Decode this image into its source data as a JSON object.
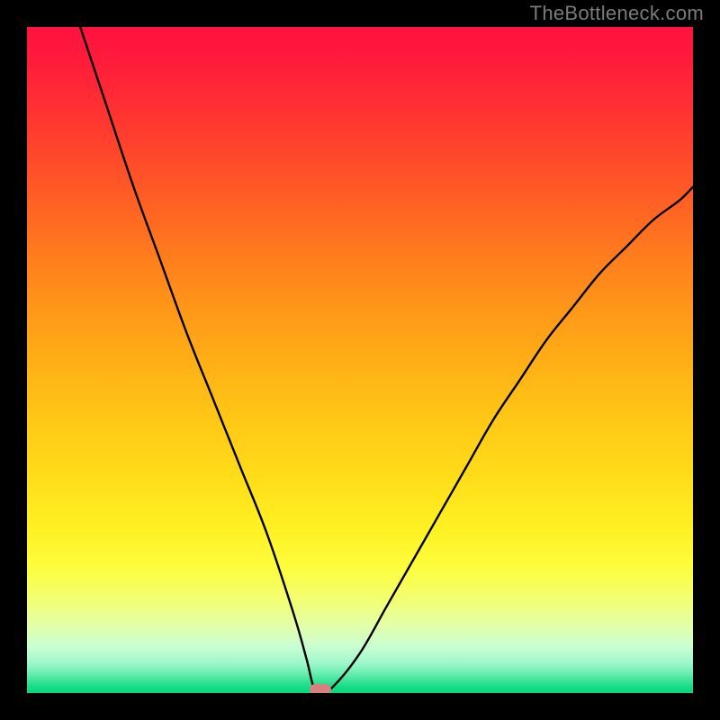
{
  "watermark": "TheBottleneck.com",
  "chart_data": {
    "type": "line",
    "title": "",
    "xlabel": "",
    "ylabel": "",
    "xlim": [
      0,
      100
    ],
    "ylim": [
      0,
      100
    ],
    "grid": false,
    "legend": false,
    "background_gradient": {
      "top_color": "#ff113f",
      "bottom_color": "#06d87e",
      "description": "red-to-green vertical gradient (bad at top, good at bottom)"
    },
    "marker": {
      "x": 44,
      "y": 0,
      "color": "#d7817f"
    },
    "series": [
      {
        "name": "bottleneck-curve",
        "x": [
          8,
          12,
          16,
          20,
          24,
          28,
          32,
          36,
          40,
          42,
          43,
          44,
          46,
          50,
          54,
          58,
          62,
          66,
          70,
          74,
          78,
          82,
          86,
          90,
          94,
          98,
          100
        ],
        "y": [
          100,
          88,
          76,
          65,
          54,
          44,
          34,
          24,
          12,
          5,
          1,
          0,
          1,
          6,
          13,
          20,
          27,
          34,
          41,
          47,
          53,
          58,
          63,
          67,
          71,
          74,
          76
        ]
      }
    ]
  }
}
